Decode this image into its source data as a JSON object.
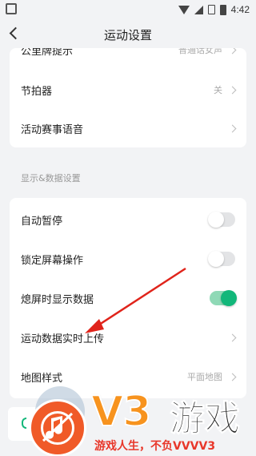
{
  "status_bar": {
    "time": "4:42"
  },
  "header": {
    "title": "运动设置"
  },
  "group1": {
    "partial_row": {
      "label": "公里牌提示",
      "value": "普通话女声"
    },
    "metronome": {
      "label": "节拍器",
      "value": "关"
    },
    "event_voice": {
      "label": "活动赛事语音"
    }
  },
  "section": {
    "title": "显示&数据设置"
  },
  "group2": {
    "auto_pause": {
      "label": "自动暂停",
      "state": "off"
    },
    "lock_screen": {
      "label": "锁定屏幕操作",
      "state": "off"
    },
    "screen_off_display": {
      "label": "熄屏时显示数据",
      "state": "on"
    },
    "realtime_upload": {
      "label": "运动数据实时上传"
    },
    "map_style": {
      "label": "地图样式",
      "value": "平面地图"
    }
  },
  "watermark": {
    "brand": "V3",
    "brand_text": "游戏",
    "slogan": "游戏人生，不负VVVV3"
  },
  "colors": {
    "accent_green": "#12b77a",
    "arrow_red": "#e0241b",
    "watermark_orange": "#f7931e",
    "background": "#f2f3f5"
  }
}
